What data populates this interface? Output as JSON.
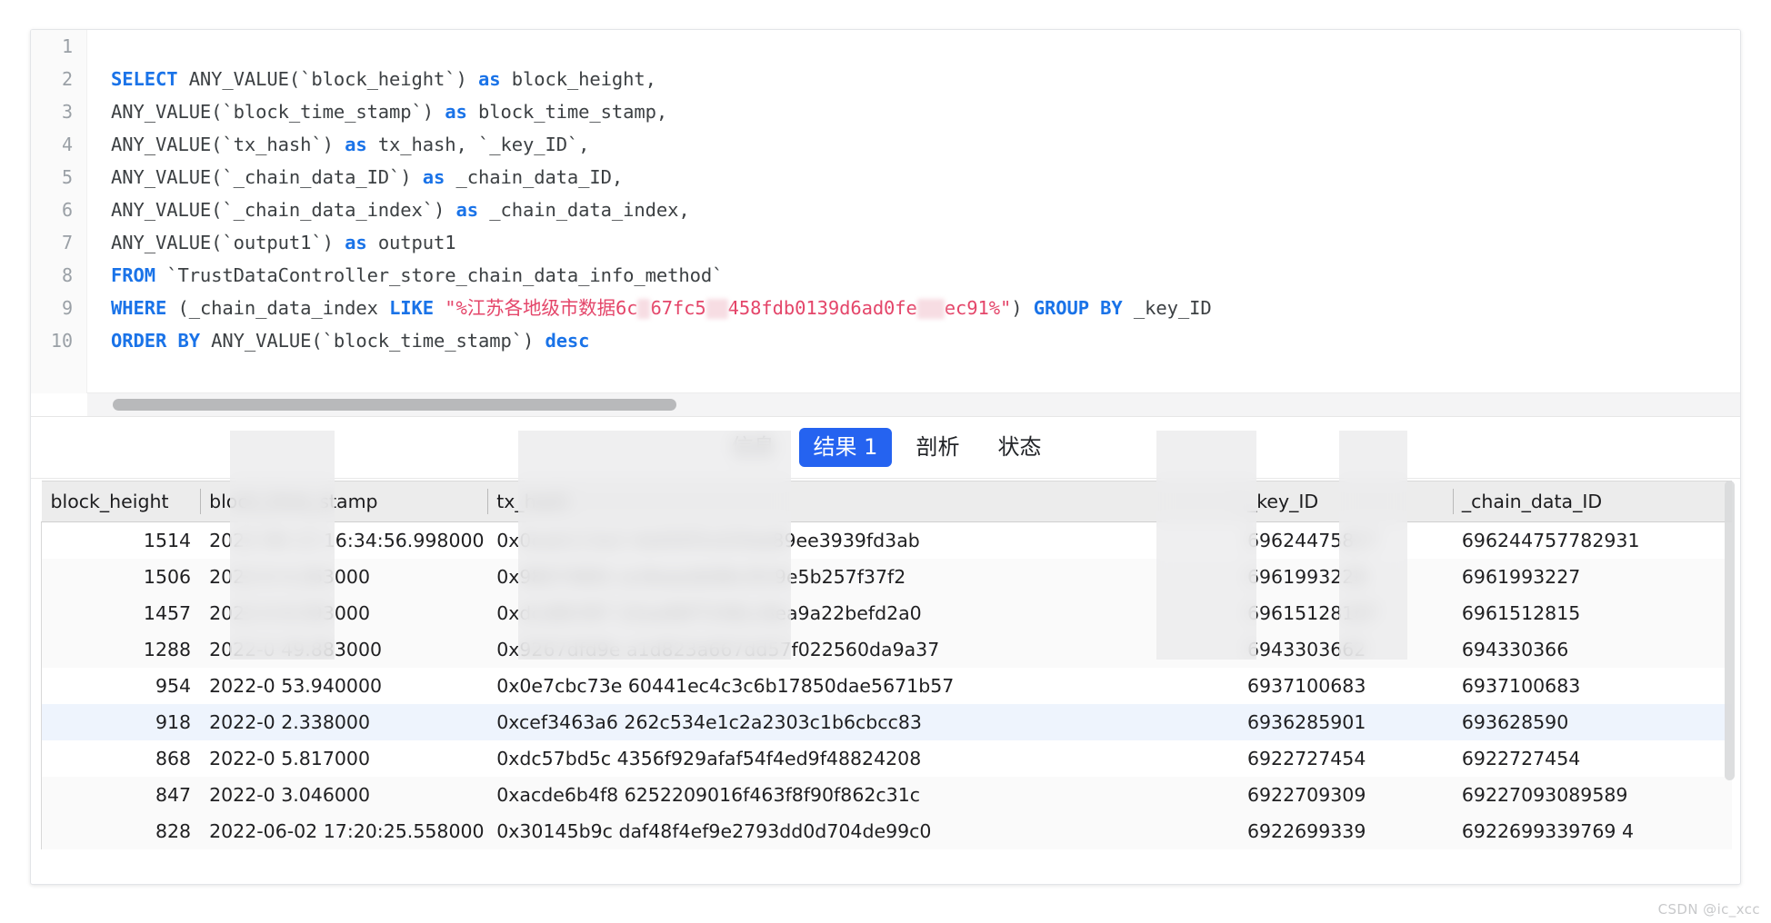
{
  "editor": {
    "language": "sql",
    "lines": [
      {
        "no": "1",
        "tokens": []
      },
      {
        "no": "2",
        "tokens": [
          {
            "t": "kw",
            "v": "SELECT"
          },
          {
            "t": "plain",
            "v": "  ANY_VALUE(`block_height`) "
          },
          {
            "t": "kw",
            "v": "as"
          },
          {
            "t": "plain",
            "v": " block_height,"
          }
        ]
      },
      {
        "no": "3",
        "tokens": [
          {
            "t": "plain",
            "v": "ANY_VALUE(`block_time_stamp`) "
          },
          {
            "t": "kw",
            "v": "as"
          },
          {
            "t": "plain",
            "v": " block_time_stamp,"
          }
        ]
      },
      {
        "no": "4",
        "tokens": [
          {
            "t": "plain",
            "v": "ANY_VALUE(`tx_hash`) "
          },
          {
            "t": "kw",
            "v": "as"
          },
          {
            "t": "plain",
            "v": " tx_hash, `_key_ID`,"
          }
        ]
      },
      {
        "no": "5",
        "tokens": [
          {
            "t": "plain",
            "v": "ANY_VALUE(`_chain_data_ID`) "
          },
          {
            "t": "kw",
            "v": "as"
          },
          {
            "t": "plain",
            "v": " _chain_data_ID,"
          }
        ]
      },
      {
        "no": "6",
        "tokens": [
          {
            "t": "plain",
            "v": "ANY_VALUE(`_chain_data_index`) "
          },
          {
            "t": "kw",
            "v": "as"
          },
          {
            "t": "plain",
            "v": " _chain_data_index,"
          }
        ]
      },
      {
        "no": "7",
        "tokens": [
          {
            "t": "plain",
            "v": "ANY_VALUE(`output1`) "
          },
          {
            "t": "kw",
            "v": "as"
          },
          {
            "t": "plain",
            "v": " output1"
          }
        ]
      },
      {
        "no": "8",
        "tokens": [
          {
            "t": "kw",
            "v": "FROM"
          },
          {
            "t": "plain",
            "v": " `TrustDataController_store_chain_data_info_method`"
          }
        ]
      },
      {
        "no": "9",
        "tokens": [
          {
            "t": "kw",
            "v": "WHERE"
          },
          {
            "t": "plain",
            "v": " (_chain_data_index "
          },
          {
            "t": "kw",
            "v": "LIKE"
          },
          {
            "t": "plain",
            "v": " "
          },
          {
            "t": "str",
            "v": "\"%江苏各地级市数据6c"
          },
          {
            "t": "redact",
            "v": "xx",
            "w": 14
          },
          {
            "t": "str",
            "v": "67fc5"
          },
          {
            "t": "redact",
            "v": "xxx",
            "w": 24
          },
          {
            "t": "str",
            "v": "458fdb0139d6ad0fe"
          },
          {
            "t": "redact",
            "v": "xxx",
            "w": 30
          },
          {
            "t": "str",
            "v": "ec91%\""
          },
          {
            "t": "plain",
            "v": ") "
          },
          {
            "t": "kw",
            "v": "GROUP BY"
          },
          {
            "t": "plain",
            "v": " _key_ID"
          }
        ]
      },
      {
        "no": "10",
        "tokens": [
          {
            "t": "kw",
            "v": "ORDER BY"
          },
          {
            "t": "plain",
            "v": " ANY_VALUE(`block_time_stamp`) "
          },
          {
            "t": "kw",
            "v": "desc"
          }
        ]
      }
    ]
  },
  "tabs": [
    {
      "label": "信息",
      "active": false
    },
    {
      "label": "结果 1",
      "active": true
    },
    {
      "label": "剖析",
      "active": false
    },
    {
      "label": "状态",
      "active": false
    }
  ],
  "table": {
    "columns": [
      {
        "key": "block_height",
        "label": "block_height",
        "align": "right"
      },
      {
        "key": "block_time_stamp",
        "label": "block_time_stamp",
        "align": "left"
      },
      {
        "key": "tx_hash",
        "label": "tx_hash",
        "align": "left"
      },
      {
        "key": "_key_ID",
        "label": "_key_ID",
        "align": "left"
      },
      {
        "key": "_chain_data_ID",
        "label": "_chain_data_ID",
        "align": "left"
      }
    ],
    "rows": [
      {
        "block_height": "1514",
        "block_time_stamp": "2022-06-13 16:34:56.998000",
        "tx_hash": "0x0eab113a3?????????????????????????4dd50f3c63fab89ee3939fd3ab",
        "_key_ID": "69624475817?????",
        "_chain_data_ID": "696244757782931",
        "highlight": "none"
      },
      {
        "block_height": "1506",
        "block_time_stamp": "2022-0???????????4.263000",
        "tx_hash": "0x98074891?????????????????????????ec9eaedb96c5fc9e5b257f37f2",
        "_key_ID": "6961993228?",
        "_chain_data_ID": "6961993227?",
        "highlight": "none"
      },
      {
        "block_height": "1457",
        "block_time_stamp": "2022-0???????????8.593000",
        "tx_hash": "0xdcd8fcf87?????????????????????????22ea96f7248cc8ea9a22befd2a0",
        "_key_ID": "69615128167",
        "_chain_data_ID": "6961512815?",
        "highlight": "alt"
      },
      {
        "block_height": "1288",
        "block_time_stamp": "2022-0??????????49.883000",
        "tx_hash": "0x9267dfd9e?????????????????????????a1d823a667dd57f022560da9a37",
        "_key_ID": "6943303662",
        "_chain_data_ID": "694330366?",
        "highlight": "none"
      },
      {
        "block_height": "954",
        "block_time_stamp": "2022-0??????????53.940000",
        "tx_hash": "0x0e7cbc73e????????????????????????60441ec4c3c6b17850dae5671b57",
        "_key_ID": "6937100683?",
        "_chain_data_ID": "6937100683",
        "highlight": "none"
      },
      {
        "block_height": "918",
        "block_time_stamp": "2022-0???????????2.338000",
        "tx_hash": "0xcef3463a6????????????????????????262c534e1c2a2303c1b6cbcc83",
        "_key_ID": "6936285901?",
        "_chain_data_ID": "693628590?",
        "highlight": "selected"
      },
      {
        "block_height": "868",
        "block_time_stamp": "2022-0???????????5.817000",
        "tx_hash": "0xdc57bd5c?????????????????????????4356f929afaf54f4ed9f48824208",
        "_key_ID": "6922727454?",
        "_chain_data_ID": "6922727454",
        "highlight": "none"
      },
      {
        "block_height": "847",
        "block_time_stamp": "2022-0???????????3.046000",
        "tx_hash": "0xacde6b4f8????????????????????????6252209016f463f8f90f862c31c",
        "_key_ID": "6922709309",
        "_chain_data_ID": "69227093089589?",
        "highlight": "none"
      },
      {
        "block_height": "828",
        "block_time_stamp": "2022-06-02 17:20:25.558000",
        "tx_hash": "0x30145b9c?????????????????????????daf48f4ef9e2793dd0d704de99c0",
        "_key_ID": "6922699339",
        "_chain_data_ID": "6922699339769 4?",
        "highlight": "alt"
      }
    ]
  },
  "watermark": {
    "text": "CSDN @ic_xcc"
  },
  "colors": {
    "accent": "#2563f0",
    "keyword": "#1a73e8",
    "string": "#e4466a",
    "header_bg": "#ececec",
    "selected_row": "#eef4fd"
  }
}
